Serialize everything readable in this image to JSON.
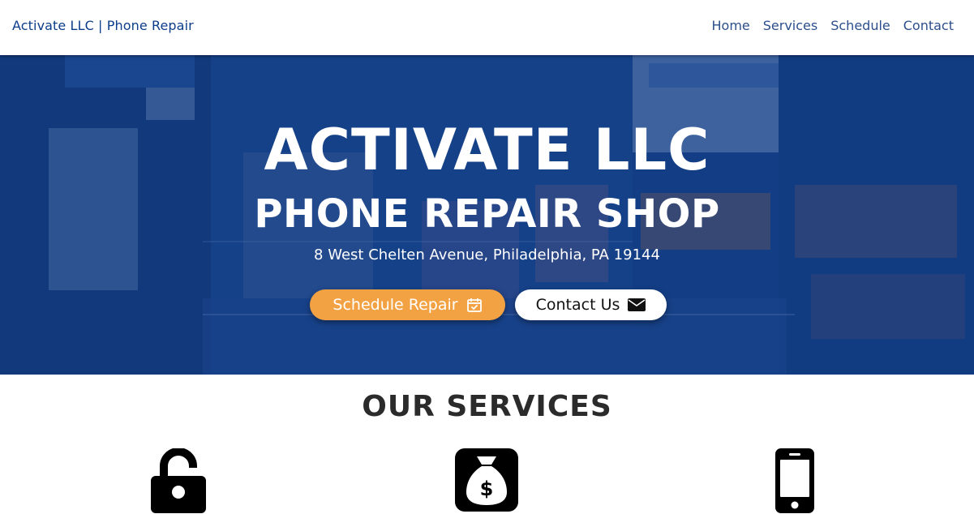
{
  "navbar": {
    "brand": "Activate LLC | Phone Repair",
    "links": [
      "Home",
      "Services",
      "Schedule",
      "Contact"
    ]
  },
  "hero": {
    "title": "ACTIVATE LLC",
    "subtitle": "PHONE REPAIR SHOP",
    "address": "8 West Chelten Avenue, Philadelphia, PA 19144",
    "schedule_button": "Schedule Repair",
    "contact_button": "Contact Us"
  },
  "services": {
    "title": "OUR SERVICES",
    "icons": [
      "unlock-icon",
      "money-bag-icon",
      "mobile-phone-icon"
    ]
  },
  "colors": {
    "brand_blue": "#0d3d8a",
    "hero_overlay": "#0e3e8a",
    "accent_orange": "#f2a243",
    "text_dark": "#2b2b2b"
  }
}
